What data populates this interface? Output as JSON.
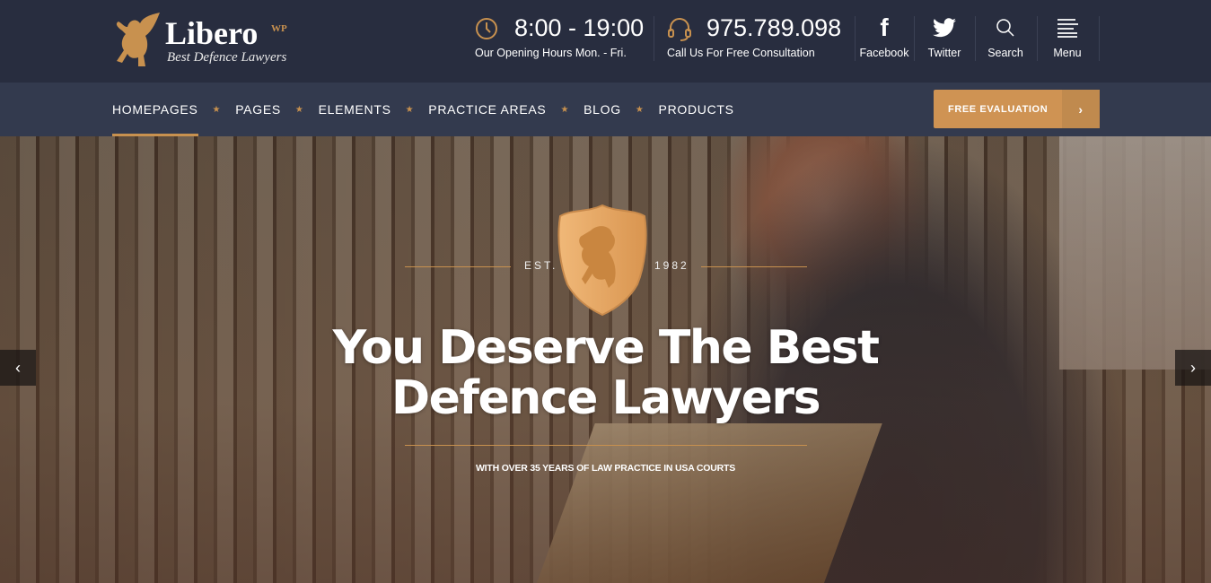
{
  "brand": {
    "name": "Libero",
    "badge": "WP",
    "tagline": "Best Defence Lawyers"
  },
  "header": {
    "hours": {
      "icon": "clock-icon",
      "value": "8:00 - 19:00",
      "label": "Our Opening Hours Mon. - Fri."
    },
    "phone": {
      "icon": "headset-icon",
      "value": "975.789.098",
      "label": "Call Us For Free Consultation"
    },
    "links": [
      {
        "icon": "facebook-icon",
        "label": "Facebook"
      },
      {
        "icon": "twitter-icon",
        "label": "Twitter"
      },
      {
        "icon": "search-icon",
        "label": "Search"
      },
      {
        "icon": "menu-icon",
        "label": "Menu"
      }
    ]
  },
  "nav": {
    "items": [
      {
        "label": "HOMEPAGES",
        "active": true
      },
      {
        "label": "PAGES"
      },
      {
        "label": "ELEMENTS"
      },
      {
        "label": "PRACTICE AREAS"
      },
      {
        "label": "BLOG"
      },
      {
        "label": "PRODUCTS"
      }
    ],
    "cta": "FREE EVALUATION",
    "cta_arrow": "›"
  },
  "hero": {
    "est_label": "EST.",
    "est_year": "1982",
    "title_line1": "You Deserve The Best",
    "title_line2": "Defence Lawyers",
    "subtitle": "WITH OVER 35 YEARS OF LAW PRACTICE IN USA COURTS",
    "prev": "‹",
    "next": "›"
  },
  "colors": {
    "accent": "#cf9353",
    "header_bg": "#282d3f",
    "nav_bg": "#333a4e"
  }
}
